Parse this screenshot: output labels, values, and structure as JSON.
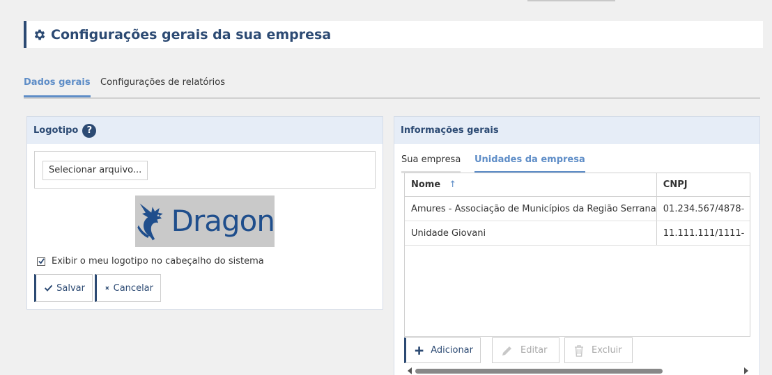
{
  "page": {
    "title": "Configurações gerais da sua empresa"
  },
  "tabs": [
    {
      "label": "Dados gerais",
      "active": true
    },
    {
      "label": "Configurações de relatórios",
      "active": false
    }
  ],
  "logo_panel": {
    "title": "Logotipo",
    "help_glyph": "?",
    "file_button": "Selecionar arquivo...",
    "logo_text": "Dragon",
    "show_logo_label": "Exibir o meu logotipo no cabeçalho do sistema",
    "show_logo_checked": true,
    "save_label": "Salvar",
    "cancel_label": "Cancelar"
  },
  "info_panel": {
    "title": "Informações gerais",
    "subtabs": [
      {
        "label": "Sua empresa",
        "active": false
      },
      {
        "label": "Unidades da empresa",
        "active": true
      }
    ],
    "columns": [
      "Nome",
      "CNPJ"
    ],
    "sort_indicator": "↑",
    "rows": [
      {
        "nome": "Amures - Associação de Municípios da Região Serrana",
        "cnpj": "01.234.567/4878-"
      },
      {
        "nome": "Unidade Giovani",
        "cnpj": "11.111.111/1111-"
      }
    ],
    "add_label": "Adicionar",
    "edit_label": "Editar",
    "delete_label": "Excluir"
  },
  "colors": {
    "accent": "#2c4a73",
    "active_tab": "#5e8dc7",
    "panel_header_bg": "#e6edf7",
    "logo_blue": "#1f4e8c"
  },
  "icons": {
    "title": "gear-icon",
    "help": "question-circle-icon",
    "save": "check-icon",
    "cancel": "x-icon",
    "add": "plus-icon",
    "edit": "pencil-icon",
    "delete": "trash-icon"
  }
}
